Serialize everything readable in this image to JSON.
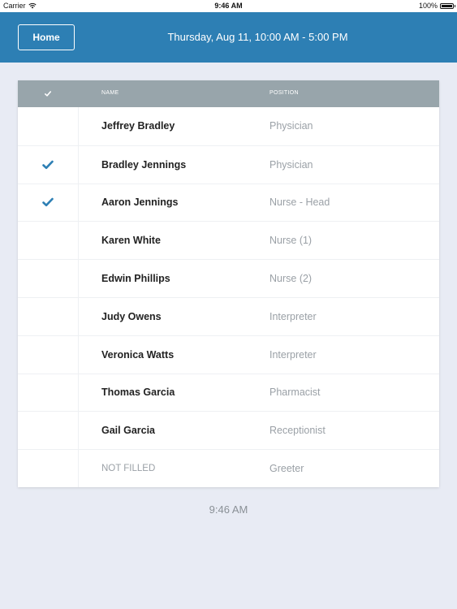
{
  "status_bar": {
    "carrier": "Carrier",
    "time": "9:46 AM",
    "battery": "100%"
  },
  "header": {
    "home_label": "Home",
    "title": "Thursday, Aug 11, 10:00 AM - 5:00 PM",
    "background_color": "#2d7fb4"
  },
  "table": {
    "columns": {
      "check": "check-icon",
      "name": "NAME",
      "position": "POSITION"
    },
    "rows": [
      {
        "checked": false,
        "name": "Jeffrey Bradley",
        "position": "Physician"
      },
      {
        "checked": true,
        "name": "Bradley Jennings",
        "position": "Physician"
      },
      {
        "checked": true,
        "name": "Aaron Jennings",
        "position": "Nurse - Head"
      },
      {
        "checked": false,
        "name": "Karen White",
        "position": "Nurse (1)"
      },
      {
        "checked": false,
        "name": "Edwin Phillips",
        "position": "Nurse (2)"
      },
      {
        "checked": false,
        "name": "Judy Owens",
        "position": "Interpreter"
      },
      {
        "checked": false,
        "name": "Veronica Watts",
        "position": "Interpreter"
      },
      {
        "checked": false,
        "name": "Thomas Garcia",
        "position": "Pharmacist"
      },
      {
        "checked": false,
        "name": "Gail Garcia",
        "position": "Receptionist"
      },
      {
        "checked": false,
        "name": "NOT FILLED",
        "position": "Greeter",
        "unfilled": true
      }
    ]
  },
  "footer": {
    "time": "9:46 AM"
  },
  "colors": {
    "accent": "#2d7fb4",
    "check": "#2d7fb4",
    "table_header": "#98a5ab",
    "page_background": "#e8ebf4"
  }
}
